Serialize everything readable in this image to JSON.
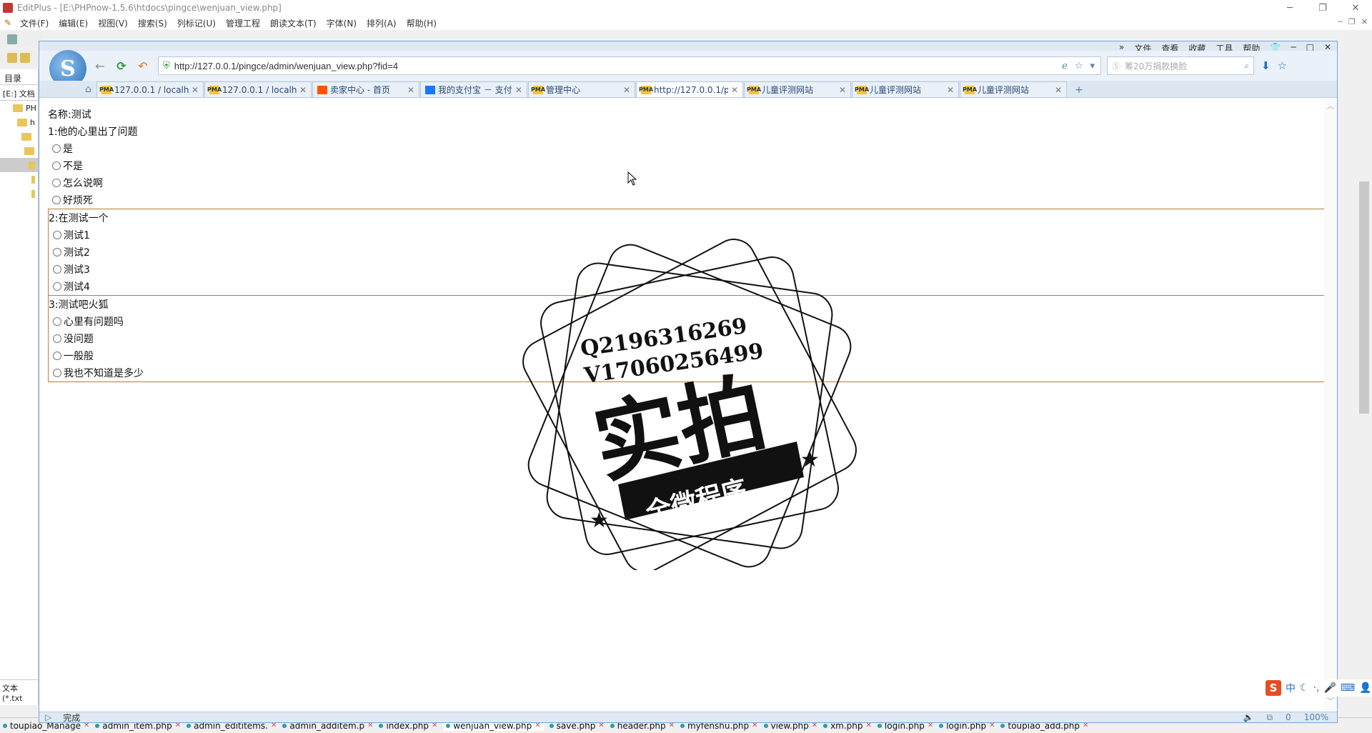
{
  "editplus": {
    "title": "EditPlus - [E:\\PHPnow-1.5.6\\htdocs\\pingce\\wenjuan_view.php]",
    "menu": [
      "文件(F)",
      "编辑(E)",
      "视图(V)",
      "搜索(S)",
      "列标记(U)",
      "管理工程",
      "朗读文本(T)",
      "字体(N)",
      "排列(A)",
      "帮助(H)"
    ],
    "left_tab": "目录",
    "left_drive": "[E:] 文档",
    "tree": [
      "PH",
      "h",
      "",
      "",
      "",
      "",
      ""
    ],
    "left_bottom": "文本 (*.txt",
    "file_tabs": [
      {
        "name": "toupiao_Manage"
      },
      {
        "name": "admin_item.php"
      },
      {
        "name": "admin_edititems."
      },
      {
        "name": "admin_additem.p"
      },
      {
        "name": "index.php"
      },
      {
        "name": "wenjuan_view.php"
      },
      {
        "name": "save.php"
      },
      {
        "name": "header.php"
      },
      {
        "name": "myfenshu.php"
      },
      {
        "name": "view.php"
      },
      {
        "name": "xm.php"
      },
      {
        "name": "login.php"
      },
      {
        "name": "login.php"
      },
      {
        "name": "toupiao_add.php"
      }
    ]
  },
  "browser": {
    "menu": [
      "»",
      "文件",
      "查看",
      "收藏",
      "工具",
      "帮助"
    ],
    "url": "http://127.0.0.1/pingce/admin/wenjuan_view.php?fid=4",
    "search_placeholder": "筹20万捐款换脸",
    "tabs": [
      {
        "title": "127.0.0.1 / localhost /",
        "fav": "pma",
        "fav_label": "PMA"
      },
      {
        "title": "127.0.0.1 / localhost /",
        "fav": "pma",
        "fav_label": "PMA"
      },
      {
        "title": "卖家中心 - 首页",
        "fav": "taobao",
        "fav_label": ""
      },
      {
        "title": "我的支付宝 － 支付宝",
        "fav": "alipay",
        "fav_label": ""
      },
      {
        "title": "管理中心",
        "fav": "pma",
        "fav_label": "PMA"
      },
      {
        "title": "http://127.0.0.1/pingc",
        "fav": "pma",
        "fav_label": "PMA"
      },
      {
        "title": "儿童评测网站",
        "fav": "pma",
        "fav_label": "PMA"
      },
      {
        "title": "儿童评测网站",
        "fav": "pma",
        "fav_label": "PMA"
      },
      {
        "title": "儿童评测网站",
        "fav": "pma",
        "fav_label": "PMA"
      }
    ],
    "active_tab": 5,
    "status": "完成",
    "zoom": "100%",
    "counter": "0"
  },
  "survey": {
    "name_line": "名称:测试",
    "questions": [
      {
        "title": "1:他的心里出了问题",
        "options": [
          "是",
          "不是",
          "怎么说啊",
          "好烦死"
        ]
      },
      {
        "title": "2:在测试一个",
        "options": [
          "测试1",
          "测试2",
          "测试3",
          "测试4"
        ]
      },
      {
        "title": "3:测试吧火狐",
        "options": [
          "心里有问题吗",
          "没问题",
          "一般般",
          "我也不知道是多少"
        ]
      }
    ]
  },
  "watermark": {
    "line1": "Q2196316269",
    "line2": "V17060256499",
    "big": "实拍",
    "ribbon": "全微程序"
  },
  "ime": {
    "items": [
      "中",
      "☾",
      "·,",
      "🎤",
      "⌨",
      "👤",
      "👕",
      "🔧"
    ]
  }
}
